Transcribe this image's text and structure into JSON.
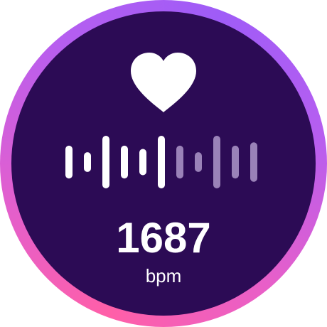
{
  "heart_rate": {
    "value": "1687",
    "unit": "bpm"
  },
  "icons": {
    "heart": "heart-icon",
    "waveform": "waveform-icon"
  },
  "waveform": {
    "bars": [
      {
        "level": 0.55,
        "active": true
      },
      {
        "level": 0.33,
        "active": true
      },
      {
        "level": 0.88,
        "active": true
      },
      {
        "level": 0.55,
        "active": true
      },
      {
        "level": 0.44,
        "active": true
      },
      {
        "level": 0.88,
        "active": true
      },
      {
        "level": 0.55,
        "active": false
      },
      {
        "level": 0.33,
        "active": false
      },
      {
        "level": 0.88,
        "active": false
      },
      {
        "level": 0.55,
        "active": false
      },
      {
        "level": 0.66,
        "active": false
      }
    ]
  },
  "colors": {
    "face": "#2c0b55",
    "ring_start": "#ff5fa8",
    "ring_end": "#9f5cf7",
    "bar_active": "#ffffff",
    "bar_inactive": "#9a82b8",
    "text": "#ffffff"
  }
}
